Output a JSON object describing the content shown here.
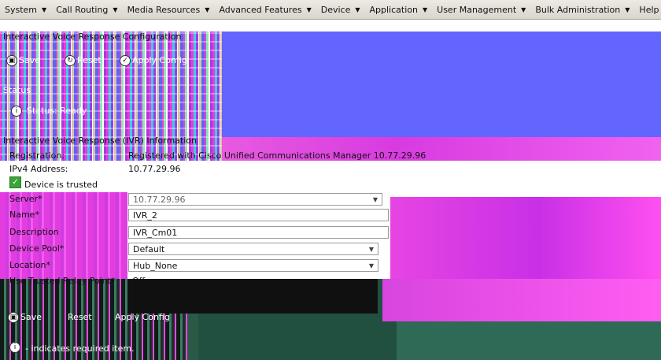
{
  "menu": {
    "items": [
      {
        "label": "System"
      },
      {
        "label": "Call Routing"
      },
      {
        "label": "Media Resources"
      },
      {
        "label": "Advanced Features"
      },
      {
        "label": "Device"
      },
      {
        "label": "Application"
      },
      {
        "label": "User Management"
      },
      {
        "label": "Bulk Administration"
      },
      {
        "label": "Help"
      }
    ]
  },
  "page": {
    "title": "Interactive Voice Response Configuration"
  },
  "toolbar": {
    "save_label": "Save",
    "reset_label": "Reset",
    "apply_config_label": "Apply Config"
  },
  "status": {
    "section_title": "Status",
    "message": "Status: Ready"
  },
  "info": {
    "section_title": "Interactive Voice Response (IVR) Information",
    "registration_label": "Registration:",
    "registration_value": "Registered with Cisco Unified Communications Manager 10.77.29.96",
    "ipv4_label": "IPv4 Address:",
    "ipv4_value": "10.77.29.96",
    "trusted_label": "Device is trusted",
    "server_label": "Server*",
    "server_value": "10.77.29.96",
    "name_label": "Name*",
    "name_value": "IVR_2",
    "description_label": "Description",
    "description_value": "IVR_Cm01",
    "device_pool_label": "Device Pool*",
    "device_pool_value": "Default",
    "location_label": "Location*",
    "location_value": "Hub_None",
    "trp_label": "Use Trusted Relay Point*",
    "trp_value": "Off"
  },
  "footer": {
    "note": "- indicates required item."
  },
  "colors": {
    "menubar": "#d8d5cc",
    "blue_panel": "#6365ff",
    "magenta": "#e645e3",
    "dark_green": "#2a5a46",
    "check_green": "#3aa33a"
  }
}
